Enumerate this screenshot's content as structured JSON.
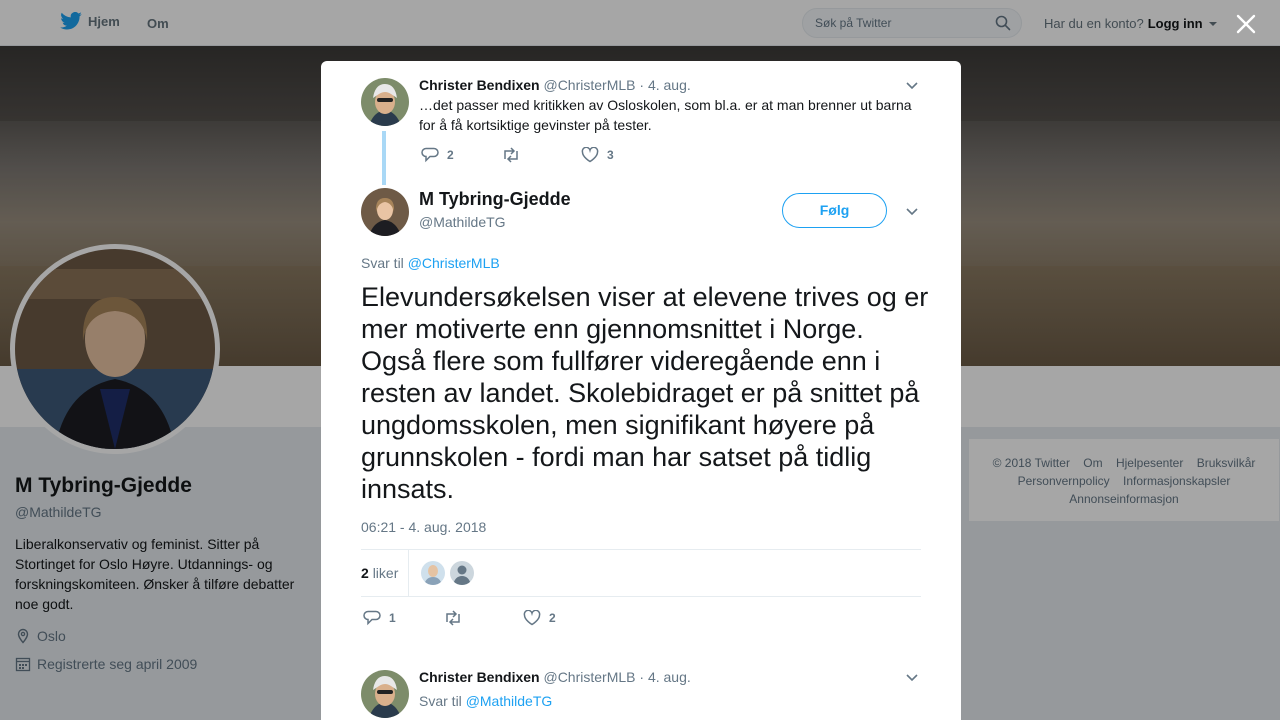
{
  "nav": {
    "home": "Hjem",
    "about": "Om",
    "search_placeholder": "Søk på Twitter",
    "account_prompt": "Har du en konto?",
    "login": "Logg inn"
  },
  "profile": {
    "name": "M Tybring-Gjedde",
    "handle": "@MathildeTG",
    "bio": "Liberalkonservativ og feminist. Sitter på Stortinget for Oslo Høyre. Utdannings- og forskningskomiteen. Ønsker å tilføre debatter noe godt.",
    "location": "Oslo",
    "joined": "Registrerte seg april 2009"
  },
  "footer": {
    "links": [
      "© 2018 Twitter",
      "Om",
      "Hjelpesenter",
      "Bruksvilkår",
      "Personvernpolicy",
      "Informasjonskapsler",
      "Annonseinformasjon"
    ]
  },
  "parent_tweet": {
    "name": "Christer Bendixen",
    "handle": "@ChristerMLB",
    "date": "· 4. aug.",
    "text": "…det passer med kritikken av Osloskolen, som bl.a. er at man brenner ut barna for å få kortsiktige gevinster på tester.",
    "replies": "2",
    "retweets": "",
    "likes": "3"
  },
  "main_tweet": {
    "name": "M Tybring-Gjedde",
    "handle": "@MathildeTG",
    "follow_label": "Følg",
    "reply_prefix": "Svar til",
    "reply_to": "@ChristerMLB",
    "text": "Elevundersøkelsen viser at elevene trives og er mer motiverte enn gjennomsnittet i Norge. Også flere som fullfører videregående enn i resten av landet. Skolebidraget er på snittet på ungdomsskolen, men signifikant høyere på grunnskolen - fordi man har satset på tidlig innsats.",
    "timestamp": "06:21 - 4. aug. 2018",
    "likes_count": "2",
    "likes_label": "liker",
    "replies": "1",
    "retweets": "",
    "likes": "2"
  },
  "reply_tweet": {
    "name": "Christer Bendixen",
    "handle": "@ChristerMLB",
    "date": "· 4. aug.",
    "reply_prefix": "Svar til",
    "reply_to": "@MathildeTG"
  },
  "colors": {
    "accent": "#1da1f2",
    "thread_line": "#a9d8f6",
    "muted": "#657786"
  }
}
